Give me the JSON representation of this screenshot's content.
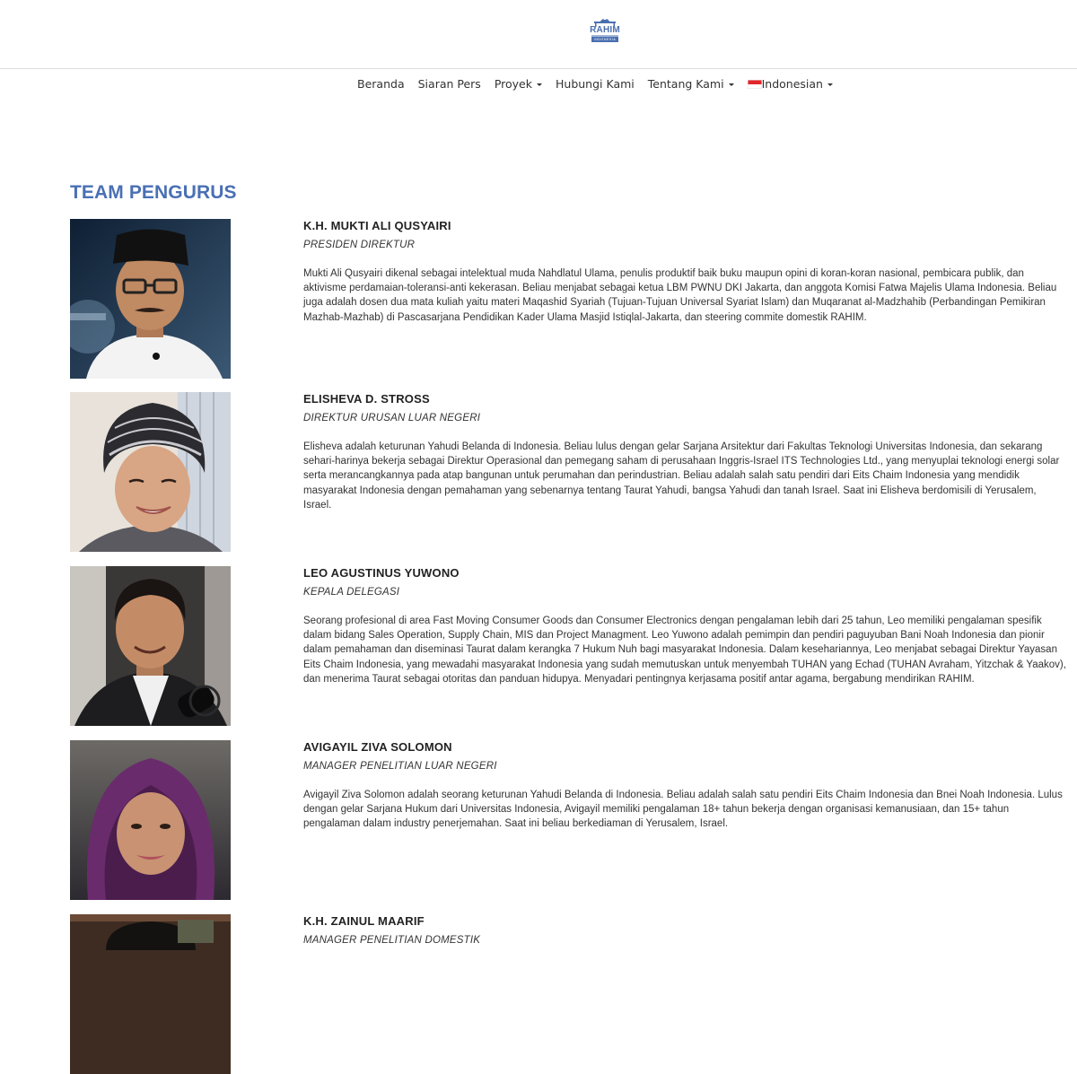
{
  "header": {
    "logo_text": "RAHIM",
    "logo_subtext": "INDONESIA"
  },
  "nav": {
    "items": [
      {
        "label": "Beranda",
        "dropdown": false
      },
      {
        "label": "Siaran Pers",
        "dropdown": false
      },
      {
        "label": "Proyek",
        "dropdown": true
      },
      {
        "label": "Hubungi Kami",
        "dropdown": false
      },
      {
        "label": "Tentang Kami",
        "dropdown": true
      },
      {
        "label": "Indonesian",
        "dropdown": true,
        "flag": "indonesia-flag-icon"
      }
    ]
  },
  "page": {
    "section_title": "TEAM PENGURUS"
  },
  "members": [
    {
      "name": "K.H. MUKTI ALI QUSYAIRI",
      "role": "PRESIDEN DIREKTUR",
      "bio": "Mukti Ali Qusyairi dikenal sebagai intelektual muda Nahdlatul Ulama, penulis produktif baik buku maupun opini di koran-koran nasional, pembicara publik, dan aktivisme perdamaian-toleransi-anti kekerasan. Beliau menjabat sebagai ketua LBM PWNU DKI Jakarta, dan anggota Komisi Fatwa Majelis Ulama Indonesia. Beliau juga adalah dosen dua mata kuliah yaitu materi Maqashid Syariah (Tujuan-Tujuan Universal Syariat Islam) dan Muqaranat al-Madzhahib (Perbandingan Pemikiran Mazhab-Mazhab) di Pascasarjana Pendidikan Kader Ulama Masjid Istiqlal-Jakarta, dan steering commite domestik RAHIM."
    },
    {
      "name": "ELISHEVA D. STROSS",
      "role": "DIREKTUR URUSAN LUAR NEGERI",
      "bio": "Elisheva adalah keturunan Yahudi Belanda di Indonesia. Beliau lulus dengan gelar Sarjana Arsitektur dari Fakultas Teknologi Universitas Indonesia, dan sekarang sehari-harinya bekerja sebagai Direktur Operasional dan pemegang saham di perusahaan Inggris-Israel ITS Technologies Ltd., yang menyuplai teknologi energi solar serta merancangkannya pada atap bangunan untuk perumahan dan perindustrian. Beliau adalah salah satu pendiri dari Eits Chaim Indonesia yang mendidik masyarakat Indonesia dengan pemahaman yang sebenarnya tentang Taurat Yahudi, bangsa Yahudi dan tanah Israel. Saat ini Elisheva berdomisili di Yerusalem, Israel."
    },
    {
      "name": "LEO AGUSTINUS YUWONO",
      "role": "KEPALA DELEGASI",
      "bio": "Seorang profesional di area Fast Moving Consumer Goods dan Consumer Electronics dengan pengalaman lebih dari 25 tahun, Leo memiliki pengalaman spesifik dalam bidang Sales Operation, Supply Chain, MIS dan Project Managment. Leo Yuwono adalah pemimpin dan pendiri paguyuban Bani Noah Indonesia dan pionir dalam pemahaman dan diseminasi Taurat dalam kerangka 7 Hukum Nuh bagi masyarakat Indonesia. Dalam kesehariannya, Leo menjabat sebagai Direktur Yayasan Eits Chaim Indonesia, yang mewadahi masyarakat Indonesia yang sudah memutuskan untuk menyembah TUHAN yang Echad (TUHAN Avraham, Yitzchak & Yaakov), dan menerima Taurat sebagai otoritas dan panduan hidupya. Menyadari pentingnya kerjasama positif antar agama, bergabung mendirikan RAHIM."
    },
    {
      "name": "AVIGAYIL ZIVA SOLOMON",
      "role": "MANAGER PENELITIAN LUAR NEGERI",
      "bio": "Avigayil Ziva Solomon adalah seorang keturunan Yahudi Belanda di Indonesia. Beliau adalah salah satu pendiri Eits Chaim Indonesia dan Bnei Noah Indonesia. Lulus dengan gelar Sarjana Hukum dari Universitas Indonesia, Avigayil memiliki pengalaman 18+ tahun bekerja dengan organisasi kemanusiaan, dan 15+ tahun pengalaman dalam industry penerjemahan. Saat ini beliau berkediaman di Yerusalem, Israel."
    },
    {
      "name": "K.H. ZAINUL MAARIF",
      "role": "MANAGER PENELITIAN DOMESTIK",
      "bio": ""
    }
  ]
}
